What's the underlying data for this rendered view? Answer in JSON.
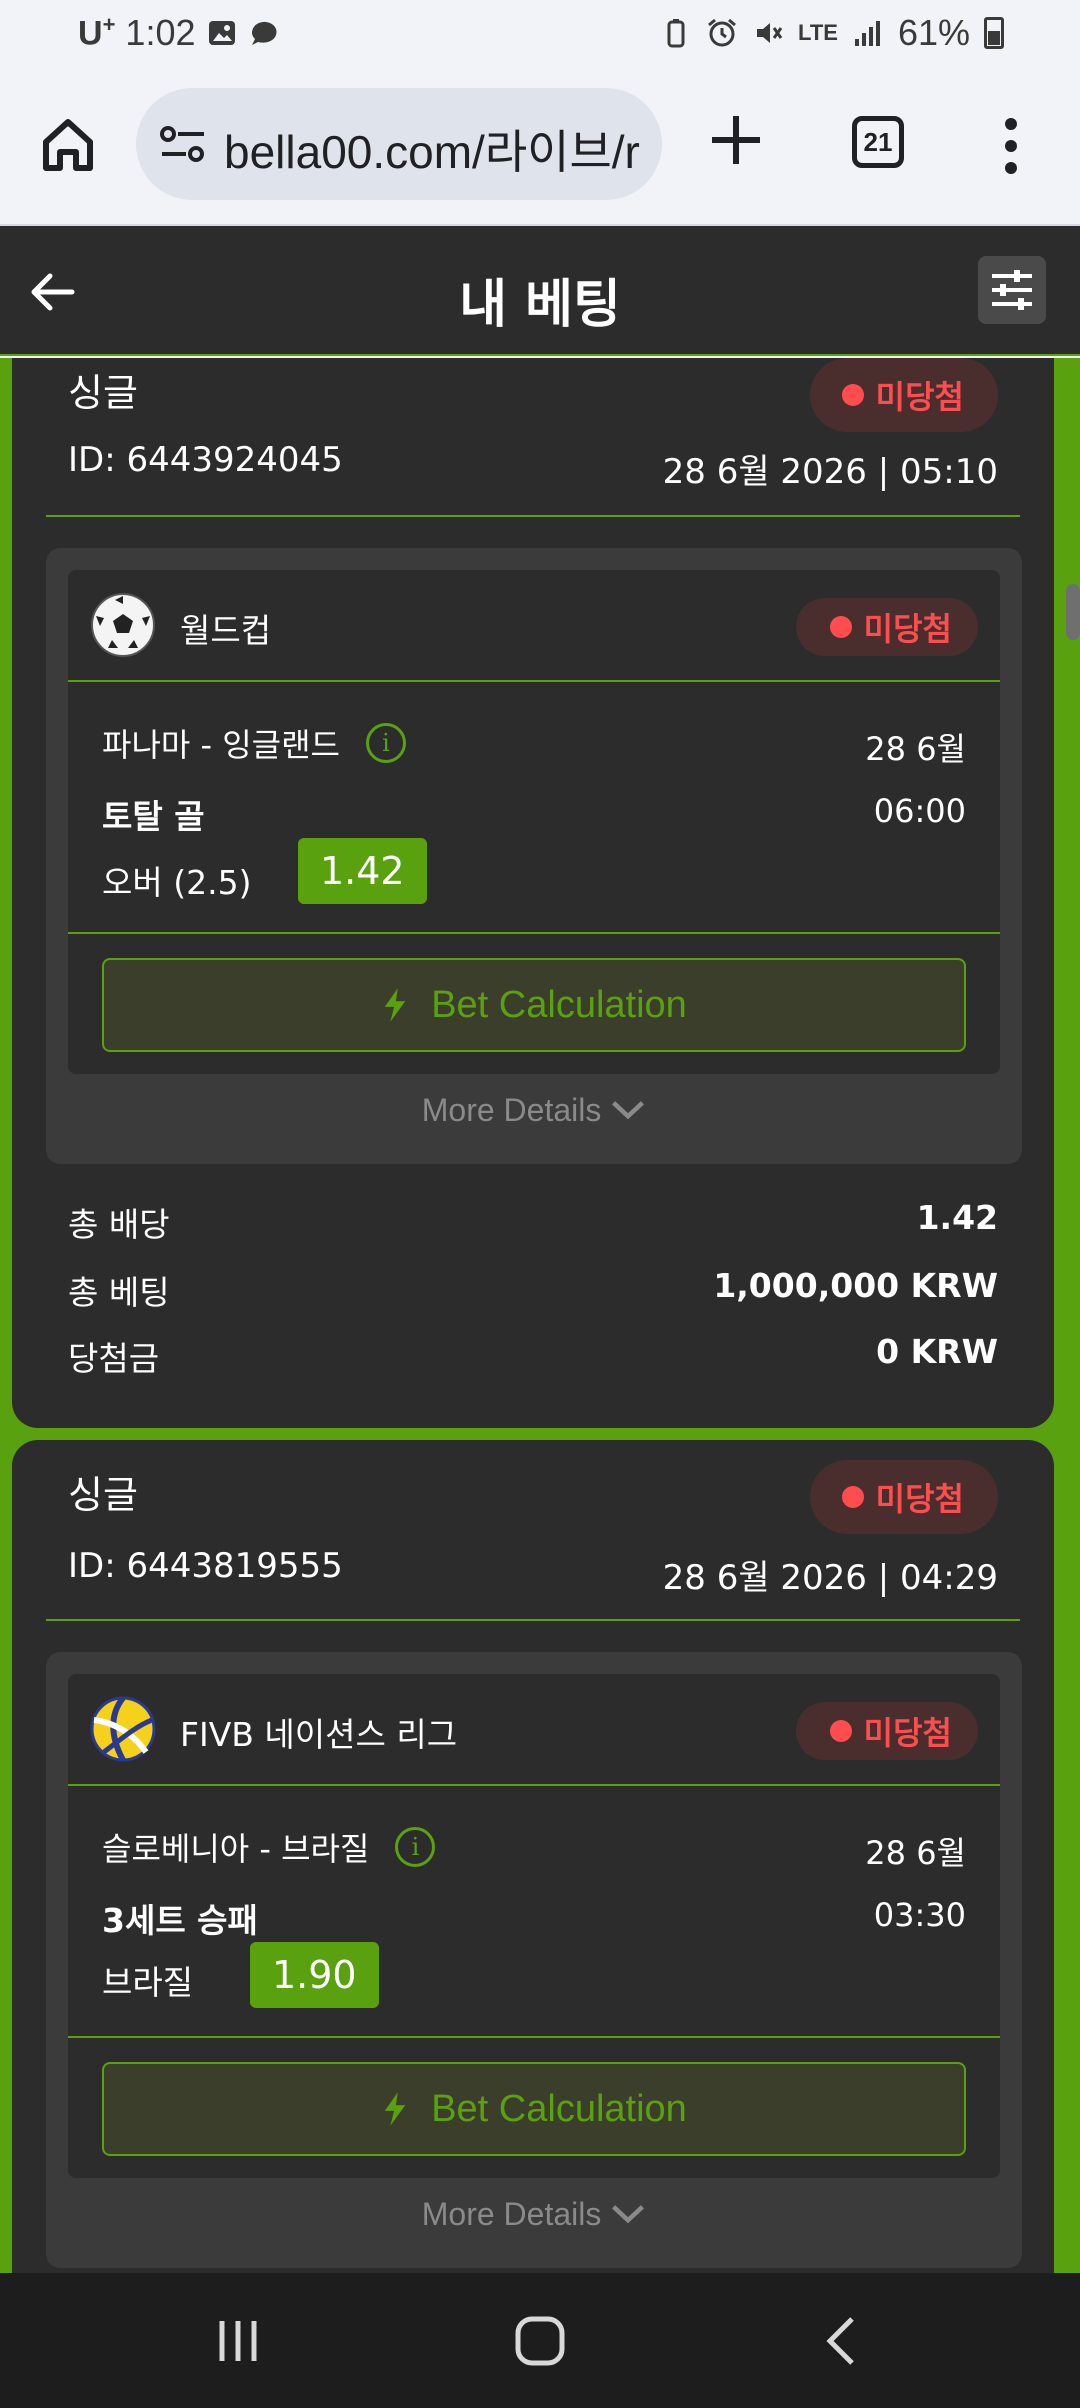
{
  "statusbar": {
    "carrier": "U",
    "carrier_sup": "+",
    "time": "1:02",
    "network": "LTE",
    "battery": "61%"
  },
  "browser": {
    "url": "bella00.com/라이브/r",
    "tab_count": "21",
    "icons": [
      "home-icon",
      "site-settings-icon",
      "plus-icon",
      "tabs-icon",
      "more-vert-icon"
    ]
  },
  "header": {
    "title": "내 베팅",
    "icons": [
      "back-arrow-icon",
      "filter-sliders-icon"
    ]
  },
  "bets": [
    {
      "type": "싱글",
      "status": "미당첨",
      "id": "ID: 6443924045",
      "date": "28 6월 2026 | 05:10",
      "selection": {
        "league": "월드컵",
        "league_icon": "soccer-ball-icon",
        "status": "미당첨",
        "match": "파나마 - 잉글랜드",
        "match_date": "28 6월",
        "market": "토탈 골",
        "match_time": "06:00",
        "pick": "오버 (2.5)",
        "odds": "1.42",
        "calc_label": "Bet Calculation"
      },
      "more_details": "More Details",
      "summary": [
        {
          "label": "총 배당",
          "value": "1.42"
        },
        {
          "label": "총 베팅",
          "value": "1,000,000 KRW"
        },
        {
          "label": "당첨금",
          "value": "0 KRW"
        }
      ]
    },
    {
      "type": "싱글",
      "status": "미당첨",
      "id": "ID: 6443819555",
      "date": "28 6월 2026 | 04:29",
      "selection": {
        "league": "FIVB 네이션스 리그",
        "league_icon": "volleyball-icon",
        "status": "미당첨",
        "match": "슬로베니아 - 브라질",
        "match_date": "28 6월",
        "market": "3세트 승패",
        "match_time": "03:30",
        "pick": "브라질",
        "odds": "1.90",
        "calc_label": "Bet Calculation"
      },
      "more_details": "More Details"
    }
  ],
  "navbar": {
    "icons": [
      "recent-apps-icon",
      "home-circle-icon",
      "back-chevron-icon"
    ]
  },
  "colors": {
    "accent": "#5aa10f",
    "lost": "#ff4d4f",
    "card": "#2c2c2c"
  }
}
